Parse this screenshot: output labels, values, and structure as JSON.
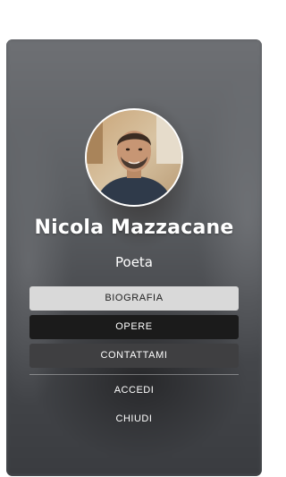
{
  "profile": {
    "name": "Nicola Mazzacane",
    "role": "Poeta"
  },
  "menu": {
    "biografia": "BIOGRAFIA",
    "opere": "OPERE",
    "contattami": "CONTATTAMI",
    "accedi": "ACCEDI",
    "chiudi": "CHIUDI"
  },
  "colors": {
    "card_background": "#55585c",
    "button_light": "#d9d9d9",
    "button_dark": "#1b1b1b",
    "button_mid": "#3f3f41",
    "text": "#ffffff"
  }
}
